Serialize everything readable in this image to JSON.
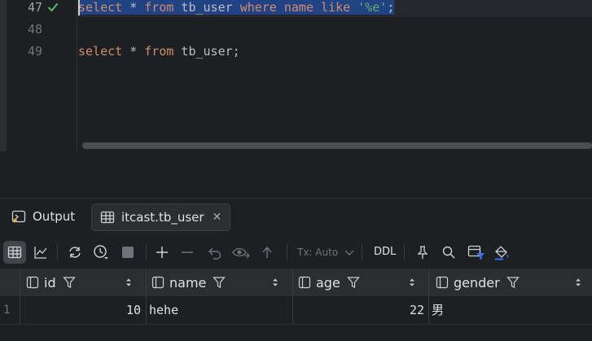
{
  "editor": {
    "lines": [
      {
        "num": "47",
        "tokens": [
          {
            "t": "select",
            "c": "kw"
          },
          {
            "t": " * ",
            "c": ""
          },
          {
            "t": "from",
            "c": "kw"
          },
          {
            "t": " tb_user ",
            "c": ""
          },
          {
            "t": "where",
            "c": "kw"
          },
          {
            "t": " name ",
            "c": "kw"
          },
          {
            "t": "like",
            "c": "kw"
          },
          {
            "t": " ",
            "c": ""
          },
          {
            "t": "'%e'",
            "c": "str"
          },
          {
            "t": ";",
            "c": ""
          }
        ]
      },
      {
        "num": "48",
        "tokens": []
      },
      {
        "num": "49",
        "tokens": [
          {
            "t": "select",
            "c": "kw"
          },
          {
            "t": " * ",
            "c": ""
          },
          {
            "t": "from",
            "c": "kw"
          },
          {
            "t": " tb_user;",
            "c": ""
          }
        ]
      }
    ]
  },
  "tabs": {
    "output": "Output",
    "table": "itcast.tb_user",
    "close": "✕"
  },
  "toolbar": {
    "tx_mode": "Tx: Auto",
    "ddl": "DDL"
  },
  "grid": {
    "columns": [
      "id",
      "name",
      "age",
      "gender"
    ],
    "rows": [
      {
        "rownum": "1",
        "id": "10",
        "name": "hehe",
        "age": "22",
        "gender": "男"
      }
    ]
  },
  "colors": {
    "keyword": "#cf8e6d",
    "string": "#6aab73",
    "selection": "#214283",
    "background": "#1e1f22"
  }
}
